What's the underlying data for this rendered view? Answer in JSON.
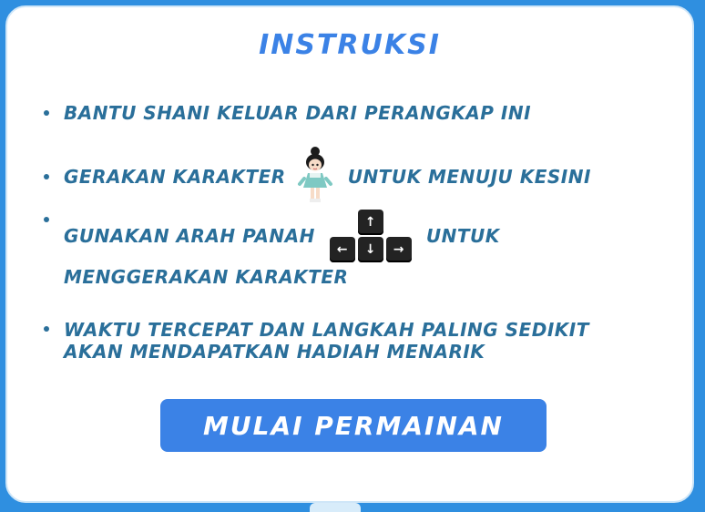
{
  "title": "Instruksi",
  "instructions": {
    "item1": "Bantu Shani keluar dari perangkap ini",
    "item2_before": "Gerakan karakter",
    "item2_after": "untuk menuju kesini",
    "item3_before": "Gunakan arah panah",
    "item3_after": "untuk",
    "item3_line2": "menggerakan karakter",
    "item4_line1": "Waktu tercepat dan langkah paling sedikit",
    "item4_line2": "akan mendapatkan hadiah menarik"
  },
  "keys": {
    "up": "↑",
    "left": "←",
    "down": "↓",
    "right": "→"
  },
  "icons": {
    "character": "character-shani-icon"
  },
  "button": {
    "start_label": "Mulai Permainan"
  },
  "colors": {
    "accent": "#3b82e6",
    "text": "#2a6f9a",
    "background": "#2f8fe0",
    "key": "#232323"
  }
}
